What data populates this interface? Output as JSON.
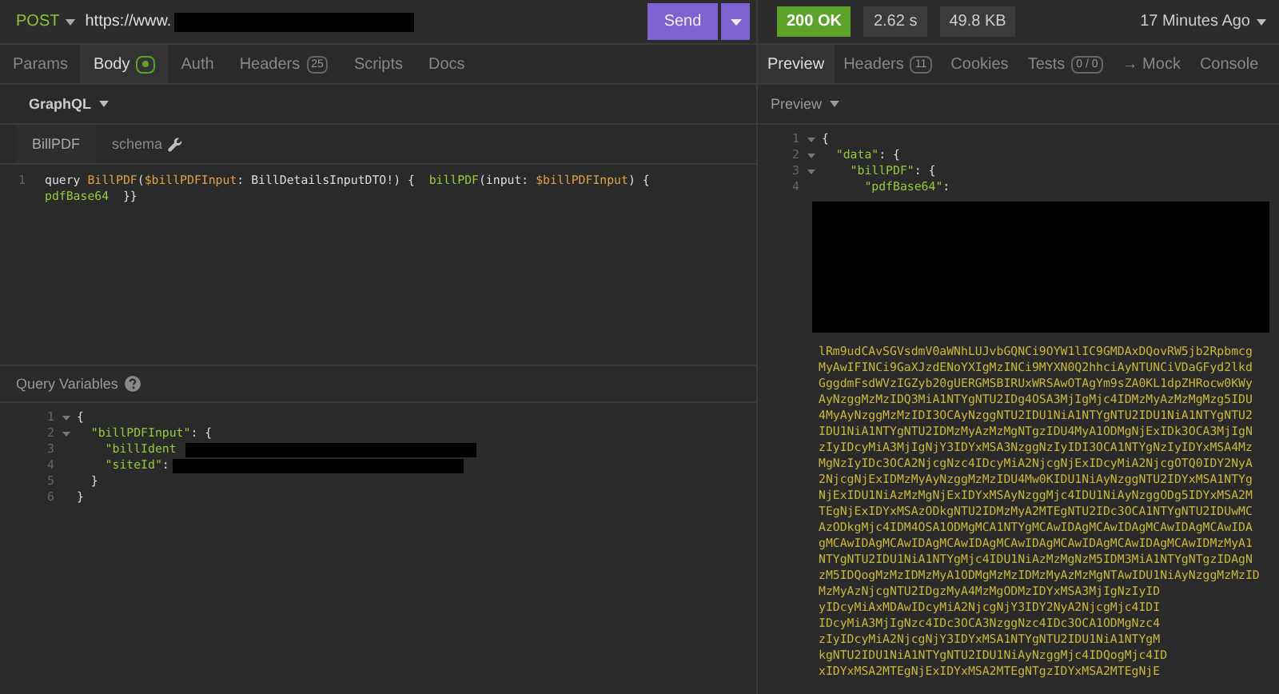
{
  "request": {
    "method": "POST",
    "url": "https://www.",
    "send": "Send"
  },
  "request_tabs": [
    {
      "label": "Params",
      "selected": false
    },
    {
      "label": "Body",
      "selected": true,
      "dot": true
    },
    {
      "label": "Auth",
      "selected": false
    },
    {
      "label": "Headers",
      "selected": false,
      "badge": "25"
    },
    {
      "label": "Scripts",
      "selected": false
    },
    {
      "label": "Docs",
      "selected": false
    }
  ],
  "body_mode": "GraphQL",
  "editor_tabs": [
    {
      "label": "BillPDF",
      "selected": true,
      "kind": "plain"
    },
    {
      "label": "schema",
      "selected": false,
      "kind": "wrench"
    }
  ],
  "query_lines": [
    {
      "number": "1",
      "tokens": [
        {
          "text": "query ",
          "kind": "plain"
        },
        {
          "text": "BillPDF",
          "kind": "name"
        },
        {
          "text": "(",
          "kind": "punct"
        },
        {
          "text": "$billPDFInput",
          "kind": "name"
        },
        {
          "text": ": ",
          "kind": "punct"
        },
        {
          "text": "BillDetailsInputDTO!",
          "kind": "plain"
        },
        {
          "text": ") {  ",
          "kind": "punct"
        },
        {
          "text": "billPDF",
          "kind": "field"
        },
        {
          "text": "(input: ",
          "kind": "punct"
        },
        {
          "text": "$billPDFInput",
          "kind": "name"
        },
        {
          "text": ") {",
          "kind": "punct"
        }
      ]
    },
    {
      "tokens": [
        {
          "text": "pdfBase64",
          "kind": "field"
        },
        {
          "text": "  }}",
          "kind": "plain"
        }
      ]
    }
  ],
  "variables": {
    "title": "Query Variables",
    "lines": [
      {
        "number": "1",
        "fold": true,
        "tokens": [
          {
            "text": "{",
            "kind": "plain"
          }
        ]
      },
      {
        "number": "2",
        "fold": true,
        "tokens": [
          {
            "text": "  \"billPDFInput\"",
            "kind": "field"
          },
          {
            "text": ": {",
            "kind": "plain"
          }
        ]
      },
      {
        "number": "3",
        "fold": false,
        "tokens": [
          {
            "text": "    \"billIdent",
            "kind": "field"
          }
        ]
      },
      {
        "number": "4",
        "fold": false,
        "tokens": [
          {
            "text": "    \"siteId\"",
            "kind": "field"
          },
          {
            "text": ":",
            "kind": "plain"
          }
        ]
      },
      {
        "number": "5",
        "fold": false,
        "tokens": [
          {
            "text": "  }",
            "kind": "plain"
          }
        ]
      },
      {
        "number": "6",
        "fold": false,
        "tokens": [
          {
            "text": "}",
            "kind": "plain"
          }
        ]
      }
    ]
  },
  "response": {
    "status": "200 OK",
    "time": "2.62 s",
    "size": "49.8 KB",
    "age": "17 Minutes Ago"
  },
  "response_tabs": [
    {
      "label": "Preview",
      "selected": true
    },
    {
      "label": "Headers",
      "selected": false,
      "badge": "11"
    },
    {
      "label": "Cookies",
      "selected": false
    },
    {
      "label": "Tests",
      "selected": false,
      "badge": "0 / 0"
    },
    {
      "label": "→ Mock",
      "selected": false
    },
    {
      "label": "Console",
      "selected": false
    }
  ],
  "preview_mode": "Preview",
  "response_lines": [
    {
      "number": "1",
      "fold": true,
      "tokens": [
        {
          "text": "{",
          "kind": "plain"
        }
      ]
    },
    {
      "number": "2",
      "fold": true,
      "tokens": [
        {
          "text": "  \"data\"",
          "kind": "field"
        },
        {
          "text": ": {",
          "kind": "plain"
        }
      ]
    },
    {
      "number": "3",
      "fold": true,
      "tokens": [
        {
          "text": "    \"billPDF\"",
          "kind": "field"
        },
        {
          "text": ": {",
          "kind": "plain"
        }
      ]
    },
    {
      "number": "4",
      "fold": false,
      "tokens": [
        {
          "text": "      \"pdfBase64\"",
          "kind": "field"
        },
        {
          "text": ":",
          "kind": "plain"
        }
      ]
    }
  ],
  "base64_lines": [
    "lRm9udCAvSGVsdmV0aWNhLUJvbGQNCi9OYW1lIC9GMDAxDQovRW5jb2Rpbmcg",
    "MyAwIFINCi9GaXJzdENoYXIgMzINCi9MYXN0Q2hhciAyNTUNCiVDaGFyd2lkd",
    "GggdmFsdWVzIGZyb20gUERGMSBIRUxWRSAwOTAgYm9sZA0KL1dpZHRocw0KWy",
    "AyNzggMzMzIDQ3MiA1NTYgNTU2IDg4OSA3MjIgMjc4IDMzMyAzMzMgMzg5IDU",
    "4MyAyNzggMzMzIDI3OCAyNzggNTU2IDU1NiA1NTYgNTU2IDU1NiA1NTYgNTU2",
    "IDU1NiA1NTYgNTU2IDMzMyAzMzMgNTgzIDU4MyA1ODMgNjExIDk3OCA3MjIgN",
    "zIyIDcyMiA3MjIgNjY3IDYxMSA3NzggNzIyIDI3OCA1NTYgNzIyIDYxMSA4Mz",
    "MgNzIyIDc3OCA2NjcgNzc4IDcyMiA2NjcgNjExIDcyMiA2NjcgOTQ0IDY2NyA",
    "2NjcgNjExIDMzMyAyNzggMzMzIDU4Mw0KIDU1NiAyNzggNTU2IDYxMSA1NTYg",
    "NjExIDU1NiAzMzMgNjExIDYxMSAyNzggMjc4IDU1NiAyNzggODg5IDYxMSA2M",
    "TEgNjExIDYxMSAzODkgNTU2IDMzMyA2MTEgNTU2IDc3OCA1NTYgNTU2IDUwMC",
    "AzODkgMjc4IDM4OSA1ODMgMCA1NTYgMCAwIDAgMCAwIDAgMCAwIDAgMCAwIDA",
    "gMCAwIDAgMCAwIDAgMCAwIDAgMCAwIDAgMCAwIDAgMCAwIDAgMCAwIDMzMyA1",
    "NTYgNTU2IDU1NiA1NTYgMjc4IDU1NiAzMzMgNzM5IDM3MiA1NTYgNTgzIDAgN",
    "zM5IDQogMzMzIDMzMyA1ODMgMzMzIDMzMyAzMzMgNTAwIDU1NiAyNzggMzMzID",
    "MzMyAzNjcgNTU2IDgzMyA4MzMgODMzIDYxMSA3MjIgNzIyID",
    "yIDcyMiAxMDAwIDcyMiA2NjcgNjY3IDY2NyA2NjcgMjc4IDI",
    "IDcyMiA3MjIgNzc4IDc3OCA3NzggNzc4IDc3OCA1ODMgNzc4",
    "zIyIDcyMiA2NjcgNjY3IDYxMSA1NTYgNTU2IDU1NiA1NTYgM",
    "kgNTU2IDU1NiA1NTYgNTU2IDU1NiAyNzggMjc4IDQogMjc4ID",
    "xIDYxMSA2MTEgNjExIDYxMSA2MTEgNTgzIDYxMSA2MTEgNjE"
  ]
}
